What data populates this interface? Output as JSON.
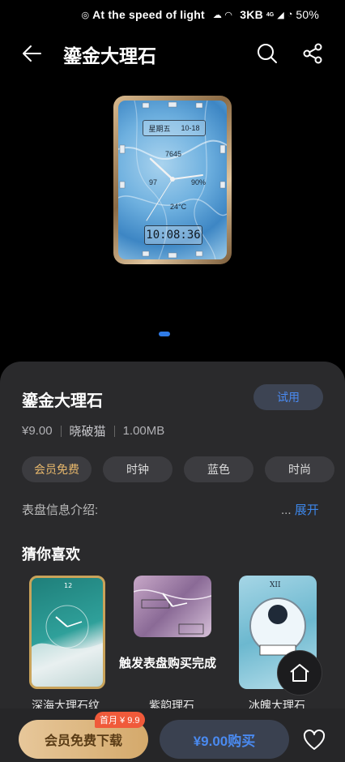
{
  "status_bar": {
    "carrier_text": "At the speed of light",
    "net_speed": "3KB",
    "signal_label": "4G",
    "battery": "50%"
  },
  "header": {
    "title": "鎏金大理石"
  },
  "preview": {
    "weekday": "星期五",
    "date": "10-18",
    "steps": "7645",
    "heart_rate": "97",
    "battery": "90%",
    "temperature": "24°C",
    "time": "10:08:36",
    "pager": {
      "current": 1,
      "total": 1
    }
  },
  "detail": {
    "name": "鎏金大理石",
    "try_label": "试用",
    "price": "¥9.00",
    "author": "晓破猫",
    "size": "1.00MB",
    "tags": [
      "会员免费",
      "时钟",
      "蓝色",
      "时尚"
    ],
    "info_label": "表盘信息介绍:",
    "info_ellipsis": "...",
    "info_expand": "展开",
    "guess_title": "猜你喜欢",
    "recommendations": [
      {
        "label": "深海大理石纹"
      },
      {
        "label": "紫韵理石"
      },
      {
        "label": "冰魄大理石"
      }
    ],
    "toast": "触发表盘购买完成"
  },
  "bottom_bar": {
    "vip_label": "会员免费下载",
    "vip_badge": "首月 ¥ 9.9",
    "buy_label": "¥9.00购买"
  },
  "colors": {
    "accent_blue": "#3d86e8",
    "vip_gold": "#d4a96b",
    "badge_red": "#f05a3a"
  }
}
